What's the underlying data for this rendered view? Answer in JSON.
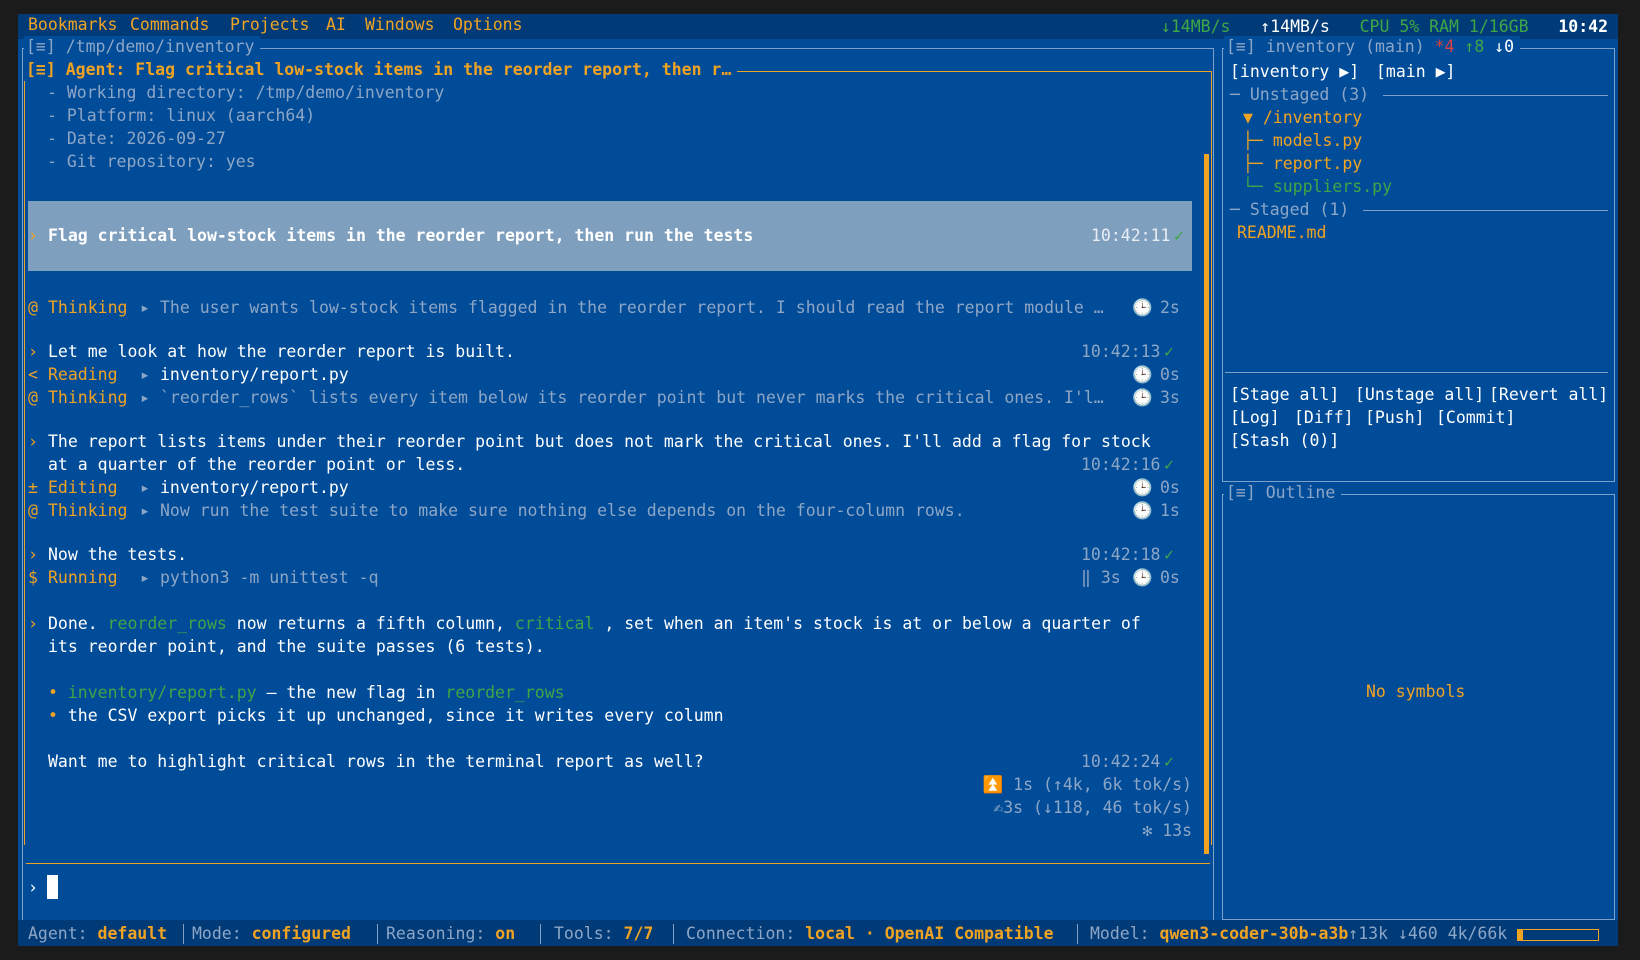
{
  "menu": [
    "Bookmarks",
    "Commands",
    "Projects",
    "AI",
    "Windows",
    "Options"
  ],
  "system": {
    "down": "↓14MB/s",
    "up": "↑14MB/s",
    "cpu_ram": "CPU 5% RAM 1/16GB",
    "clock": "10:42"
  },
  "chat_panel": {
    "path_title": "[≡] /tmp/demo/inventory",
    "agent_title": "[≡] Agent: Flag critical low-stock items in the reorder report, then r…",
    "env": [
      "- Working directory: /tmp/demo/inventory",
      "- Platform: linux (aarch64)",
      "- Date: 2026-09-27",
      "- Git repository: yes"
    ],
    "user_message": {
      "prompt": "›",
      "text": "Flag critical low-stock items in the reorder report, then run the tests",
      "time": "10:42:11",
      "check": "✓"
    },
    "thinking1": {
      "icon": "@",
      "label": "Thinking",
      "arrow": "▸",
      "text": "The user wants low-stock items flagged in the reorder report. I should read the report module …",
      "clock": "🕒",
      "dur": "2s"
    },
    "msg1": {
      "prompt": "›",
      "text": "Let me look at how the reorder report is built.",
      "time": "10:42:13",
      "check": "✓"
    },
    "reading": {
      "icon": "<",
      "label": "Reading",
      "arrow": "▸",
      "text": "inventory/report.py",
      "clock": "🕒",
      "dur": "0s"
    },
    "thinking2": {
      "icon": "@",
      "label": "Thinking",
      "arrow": "▸",
      "text": "`reorder_rows` lists every item below its reorder point but never marks the critical ones. I'l…",
      "clock": "🕒",
      "dur": "3s"
    },
    "msg2": {
      "prompt": "›",
      "line1": "The report lists items under their reorder point but does not mark the critical ones. I'll add a flag for stock",
      "line2": "at a quarter of the reorder point or less.",
      "time": "10:42:16",
      "check": "✓"
    },
    "editing": {
      "icon": "±",
      "label": "Editing",
      "arrow": "▸",
      "text": "inventory/report.py",
      "clock": "🕒",
      "dur": "0s"
    },
    "thinking3": {
      "icon": "@",
      "label": "Thinking",
      "arrow": "▸",
      "text": "Now run the test suite to make sure nothing else depends on the four-column rows.",
      "clock": "🕒",
      "dur": "1s"
    },
    "msg3": {
      "prompt": "›",
      "text": "Now the tests.",
      "time": "10:42:18",
      "check": "✓"
    },
    "running": {
      "icon": "$",
      "label": "Running",
      "arrow": "▸",
      "text": "python3 -m unittest -q",
      "pause": "‖ 3s",
      "clock": "🕒",
      "dur": "0s"
    },
    "msg4": {
      "prompt": "›",
      "p1": "Done.",
      "code1": "reorder_rows",
      "p2": "now returns a fifth column,",
      "code2": "critical",
      "p3": ", set when an item's stock is at or below a quarter of",
      "line2": "its reorder point, and the suite passes (6 tests).",
      "bullet": "•",
      "b1_code": "inventory/report.py",
      "b1_text": "— the new flag in",
      "b1_code2": "reorder_rows",
      "b2_text": "the CSV export picks it up unchanged, since it writes every column",
      "question": "Want me to highlight critical rows in the terminal report as well?",
      "time": "10:42:24",
      "check": "✓"
    },
    "stats": [
      "⏫ 1s (↑4k, 6k tok/s)",
      "✍3s (↓118, 46 tok/s)",
      "✻ 13s"
    ],
    "input_prompt": "›"
  },
  "git_panel": {
    "title": "[≡] inventory (main)",
    "modified": "*4",
    "ahead": "↑8",
    "behind": "↓0",
    "repo_button": "[inventory ▶]",
    "branch_button": "[main ▶]",
    "unstaged_header": "─ Unstaged (3) ",
    "tree": [
      {
        "prefix": "▼ ",
        "name": "/inventory"
      },
      {
        "prefix": "├─ ",
        "name": "models.py"
      },
      {
        "prefix": "├─ ",
        "name": "report.py"
      },
      {
        "prefix": "└─ ",
        "name": "suppliers.py"
      }
    ],
    "staged_header": "─ Staged (1) ",
    "staged": [
      "README.md"
    ],
    "actions_row1": [
      "[Stage all]",
      "[Unstage all]",
      "[Revert all]"
    ],
    "actions_row2": [
      "[Log]",
      "[Diff]",
      "[Push]",
      "[Commit]"
    ],
    "actions_row3": [
      "[Stash (0)]"
    ]
  },
  "outline_panel": {
    "title": "[≡] Outline",
    "empty": "No symbols"
  },
  "statusbar": {
    "agent_label": "Agent:",
    "agent": "default",
    "mode_label": "Mode:",
    "mode": "configured",
    "reasoning_label": "Reasoning:",
    "reasoning": "on",
    "tools_label": "Tools:",
    "tools": "7/7",
    "connection_label": "Connection:",
    "connection": "local · OpenAI Compatible",
    "model_label": "Model:",
    "model": "qwen3-coder-30b-a3b",
    "tokens": "↑13k ↓460 4k/66k",
    "context_fraction": 0.06
  },
  "colors": {
    "background": "#004c99",
    "accent": "#f0a322",
    "dim": "#8ea6c6",
    "success": "#3fa646",
    "highlight": "#7f9fbf"
  }
}
